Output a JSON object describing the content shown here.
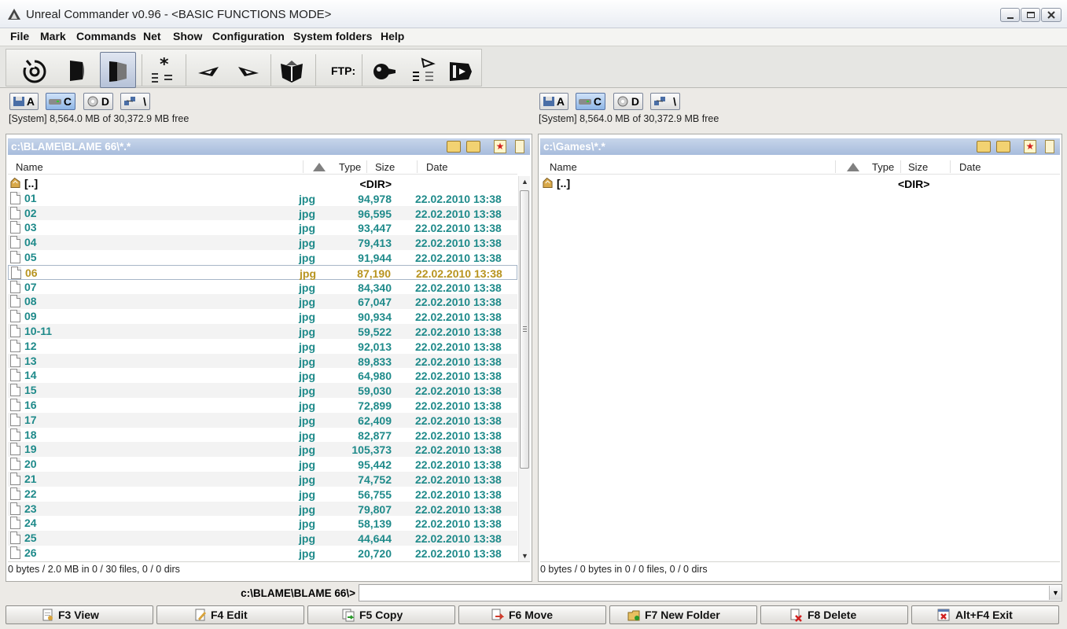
{
  "window": {
    "title": "Unreal Commander v0.96 - <BASIC FUNCTIONS MODE>",
    "min_icon": "minimize-icon",
    "max_icon": "maximize-icon",
    "close_icon": "close-icon"
  },
  "menu": [
    "File",
    "Mark",
    "Commands",
    "Net",
    "Show",
    "Configuration",
    "System folders",
    "Help"
  ],
  "toolbar": {
    "ftp_label": "FTP:",
    "icons": [
      "refresh-icon",
      "brief-view-icon",
      "full-view-icon",
      "select-mask-icon",
      "back-icon",
      "forward-icon",
      "connect-icon",
      "ftp-connect-icon",
      "ftp-list-icon",
      "archive-icon"
    ]
  },
  "drives": {
    "labels": [
      "A",
      "C",
      "D",
      "\\"
    ],
    "selected": "C"
  },
  "left_panel": {
    "free_info": "[System]  8,564.0 MB of  30,372.9 MB free",
    "path": "c:\\BLAME\\BLAME 66\\*.*",
    "columns": {
      "name": "Name",
      "type": "Type",
      "size": "Size",
      "date": "Date"
    },
    "updir": {
      "name": "[..]",
      "size": "<DIR>"
    },
    "files": [
      {
        "name": "01",
        "type": "jpg",
        "size": "94,978",
        "date": "22.02.2010 13:38"
      },
      {
        "name": "02",
        "type": "jpg",
        "size": "96,595",
        "date": "22.02.2010 13:38"
      },
      {
        "name": "03",
        "type": "jpg",
        "size": "93,447",
        "date": "22.02.2010 13:38"
      },
      {
        "name": "04",
        "type": "jpg",
        "size": "79,413",
        "date": "22.02.2010 13:38"
      },
      {
        "name": "05",
        "type": "jpg",
        "size": "91,944",
        "date": "22.02.2010 13:38"
      },
      {
        "name": "06",
        "type": "jpg",
        "size": "87,190",
        "date": "22.02.2010 13:38"
      },
      {
        "name": "07",
        "type": "jpg",
        "size": "84,340",
        "date": "22.02.2010 13:38"
      },
      {
        "name": "08",
        "type": "jpg",
        "size": "67,047",
        "date": "22.02.2010 13:38"
      },
      {
        "name": "09",
        "type": "jpg",
        "size": "90,934",
        "date": "22.02.2010 13:38"
      },
      {
        "name": "10-11",
        "type": "jpg",
        "size": "59,522",
        "date": "22.02.2010 13:38"
      },
      {
        "name": "12",
        "type": "jpg",
        "size": "92,013",
        "date": "22.02.2010 13:38"
      },
      {
        "name": "13",
        "type": "jpg",
        "size": "89,833",
        "date": "22.02.2010 13:38"
      },
      {
        "name": "14",
        "type": "jpg",
        "size": "64,980",
        "date": "22.02.2010 13:38"
      },
      {
        "name": "15",
        "type": "jpg",
        "size": "59,030",
        "date": "22.02.2010 13:38"
      },
      {
        "name": "16",
        "type": "jpg",
        "size": "72,899",
        "date": "22.02.2010 13:38"
      },
      {
        "name": "17",
        "type": "jpg",
        "size": "62,409",
        "date": "22.02.2010 13:38"
      },
      {
        "name": "18",
        "type": "jpg",
        "size": "82,877",
        "date": "22.02.2010 13:38"
      },
      {
        "name": "19",
        "type": "jpg",
        "size": "105,373",
        "date": "22.02.2010 13:38"
      },
      {
        "name": "20",
        "type": "jpg",
        "size": "95,442",
        "date": "22.02.2010 13:38"
      },
      {
        "name": "21",
        "type": "jpg",
        "size": "74,752",
        "date": "22.02.2010 13:38"
      },
      {
        "name": "22",
        "type": "jpg",
        "size": "56,755",
        "date": "22.02.2010 13:38"
      },
      {
        "name": "23",
        "type": "jpg",
        "size": "79,807",
        "date": "22.02.2010 13:38"
      },
      {
        "name": "24",
        "type": "jpg",
        "size": "58,139",
        "date": "22.02.2010 13:38"
      },
      {
        "name": "25",
        "type": "jpg",
        "size": "44,644",
        "date": "22.02.2010 13:38"
      },
      {
        "name": "26",
        "type": "jpg",
        "size": "20,720",
        "date": "22.02.2010 13:38"
      }
    ],
    "cursor_file": "06",
    "status": "0 bytes / 2.0 MB in 0 / 30 files, 0 / 0 dirs"
  },
  "right_panel": {
    "free_info": "[System]  8,564.0 MB of  30,372.9 MB free",
    "path": "c:\\Games\\*.*",
    "columns": {
      "name": "Name",
      "type": "Type",
      "size": "Size",
      "date": "Date"
    },
    "updir": {
      "name": "[..]",
      "size": "<DIR>"
    },
    "status": "0 bytes / 0 bytes in 0 / 0 files, 0 / 0 dirs"
  },
  "command_line": {
    "path": "c:\\BLAME\\BLAME 66\\>",
    "value": ""
  },
  "fkeys": [
    {
      "label": "F3 View",
      "icon": "view-icon"
    },
    {
      "label": "F4 Edit",
      "icon": "edit-icon"
    },
    {
      "label": "F5 Copy",
      "icon": "copy-icon"
    },
    {
      "label": "F6 Move",
      "icon": "move-icon"
    },
    {
      "label": "F7 New Folder",
      "icon": "new-folder-icon"
    },
    {
      "label": "F8 Delete",
      "icon": "delete-icon"
    },
    {
      "label": "Alt+F4 Exit",
      "icon": "exit-icon"
    }
  ],
  "colors": {
    "file_text": "#1e8a8a",
    "cursor_text": "#b89420",
    "panel_header": "#a7bcdc"
  }
}
